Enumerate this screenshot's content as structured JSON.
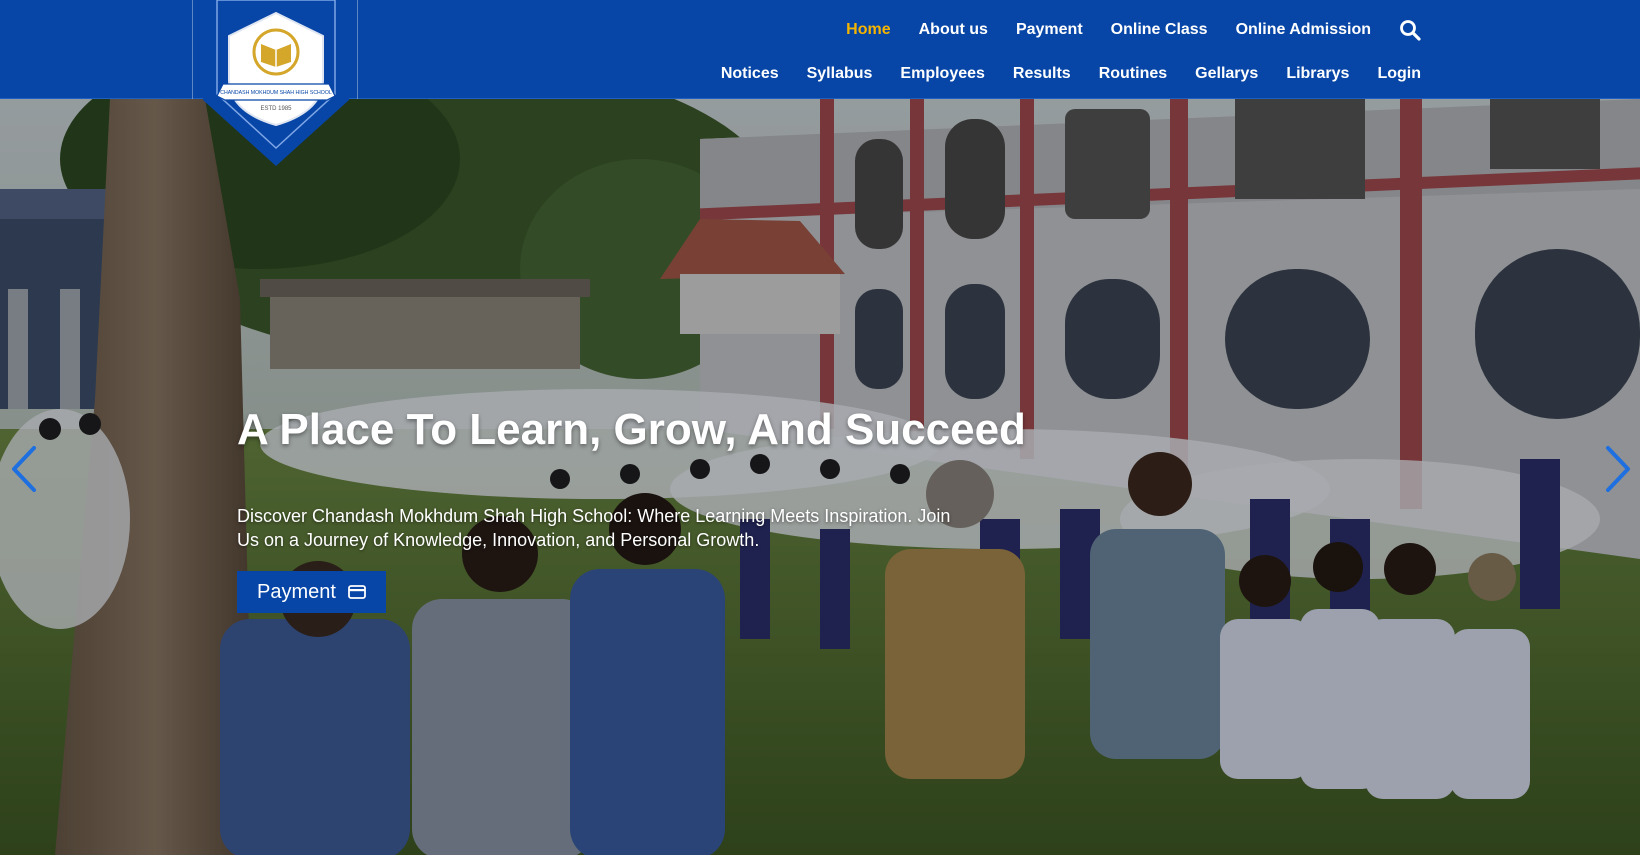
{
  "school": {
    "name": "Chandash Mokhdum Shah High School",
    "logo_text": "CHANDASH MOKHDUM SHAH HIGH SCHOOL",
    "estd": "ESTD 1985"
  },
  "nav": {
    "row1": [
      "Home",
      "About us",
      "Payment",
      "Online Class",
      "Online Admission"
    ],
    "row2": [
      "Notices",
      "Syllabus",
      "Employees",
      "Results",
      "Routines",
      "Gellarys",
      "Librarys",
      "Login"
    ],
    "active": "Home",
    "search_icon": "search-icon"
  },
  "hero": {
    "title": "A Place To Learn, Grow, And Succeed",
    "description": "Discover Chandash Mokhdum Shah High School: Where Learning Meets Inspiration. Join Us on a Journey of Knowledge, Innovation, and Personal Growth.",
    "button_label": "Payment",
    "button_icon": "credit-card-icon",
    "prev_icon": "chevron-left-icon",
    "next_icon": "chevron-right-icon"
  },
  "colors": {
    "header_bg": "#0746a6",
    "active_link": "#f4b400",
    "button_bg": "#0746a6",
    "arrow": "#1e6fe0"
  }
}
